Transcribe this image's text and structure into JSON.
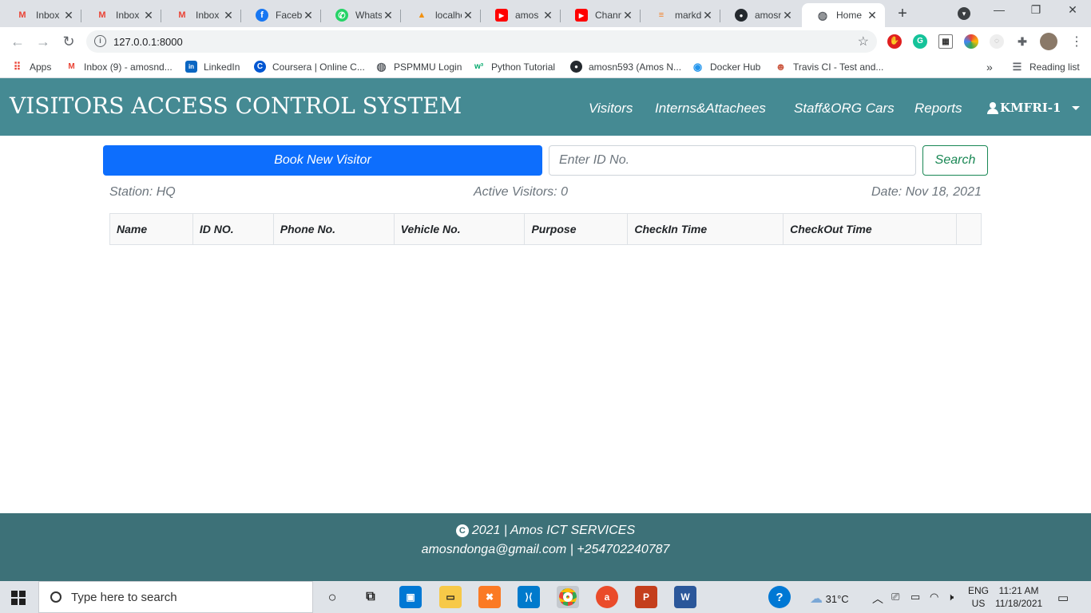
{
  "browser": {
    "tabs": [
      {
        "label": "Inbox (",
        "icon": "gmail-icon",
        "glyph": "M",
        "color": "#ea4335"
      },
      {
        "label": "Inbox",
        "icon": "gmail-icon",
        "glyph": "M",
        "color": "#ea4335"
      },
      {
        "label": "Inbox (",
        "icon": "gmail-icon",
        "glyph": "M",
        "color": "#ea4335"
      },
      {
        "label": "Facebo",
        "icon": "facebook-icon",
        "glyph": "f",
        "color": "#1877f2"
      },
      {
        "label": "Whats",
        "icon": "whatsapp-icon",
        "glyph": "✆",
        "color": "#25d366"
      },
      {
        "label": "localho",
        "icon": "phpmyadmin-icon",
        "glyph": "▲",
        "color": "#f29111"
      },
      {
        "label": "amos r",
        "icon": "youtube-icon",
        "glyph": "▶",
        "color": "#ff0000"
      },
      {
        "label": "Chann",
        "icon": "youtube-icon",
        "glyph": "▶",
        "color": "#ff0000"
      },
      {
        "label": "markd",
        "icon": "stackoverflow-icon",
        "glyph": "≡",
        "color": "#f48024"
      },
      {
        "label": "amosn",
        "icon": "github-icon",
        "glyph": "●",
        "color": "#24292e"
      },
      {
        "label": "Home",
        "icon": "globe-icon",
        "glyph": "◍",
        "color": "#5f6368"
      }
    ],
    "url": "127.0.0.1:8000",
    "bookmarks": [
      {
        "label": "Apps",
        "icon": "apps-grid-icon",
        "glyph": "⠿",
        "color": "#ea4335"
      },
      {
        "label": "Inbox (9) - amosnd...",
        "icon": "gmail-icon",
        "glyph": "M",
        "color": "#ea4335"
      },
      {
        "label": "LinkedIn",
        "icon": "linkedin-icon",
        "glyph": "in",
        "color": "#0a66c2"
      },
      {
        "label": "Coursera | Online C...",
        "icon": "coursera-icon",
        "glyph": "C",
        "color": "#0056d2"
      },
      {
        "label": "PSPMMU Login",
        "icon": "globe-icon",
        "glyph": "◍",
        "color": "#5f6368"
      },
      {
        "label": "Python Tutorial",
        "icon": "w3schools-icon",
        "glyph": "w³",
        "color": "#04aa6d"
      },
      {
        "label": "amosn593 (Amos N...",
        "icon": "github-icon",
        "glyph": "●",
        "color": "#24292e"
      },
      {
        "label": "Docker Hub",
        "icon": "docker-icon",
        "glyph": "◉",
        "color": "#2496ed"
      },
      {
        "label": "Travis CI - Test and...",
        "icon": "travis-icon",
        "glyph": "☻",
        "color": "#cd5c45"
      }
    ],
    "more": "»",
    "reading_list": "Reading list"
  },
  "navbar": {
    "brand": "VISITORS ACCESS CONTROL SYSTEM",
    "links": [
      "Visitors",
      "Interns&Attachees",
      "Staff&ORG Cars",
      "Reports"
    ],
    "user": "KMFRI-1"
  },
  "actions": {
    "book_label": "Book New Visitor",
    "id_placeholder": "Enter ID No.",
    "search_label": "Search"
  },
  "info": {
    "station": "Station: HQ",
    "active": "Active Visitors: 0",
    "date": "Date: Nov 18, 2021"
  },
  "table": {
    "columns": [
      "Name",
      "ID NO.",
      "Phone No.",
      "Vehicle No.",
      "Purpose",
      "CheckIn Time",
      "CheckOut Time",
      ""
    ],
    "rows": []
  },
  "footer": {
    "line1": "2021 | Amos ICT SERVICES",
    "line2": "amosndonga@gmail.com | +254702240787"
  },
  "taskbar": {
    "search_placeholder": "Type here to search",
    "weather": "31°C",
    "lang": "ENG",
    "region": "US",
    "time": "11:21 AM",
    "date": "11/18/2021"
  }
}
